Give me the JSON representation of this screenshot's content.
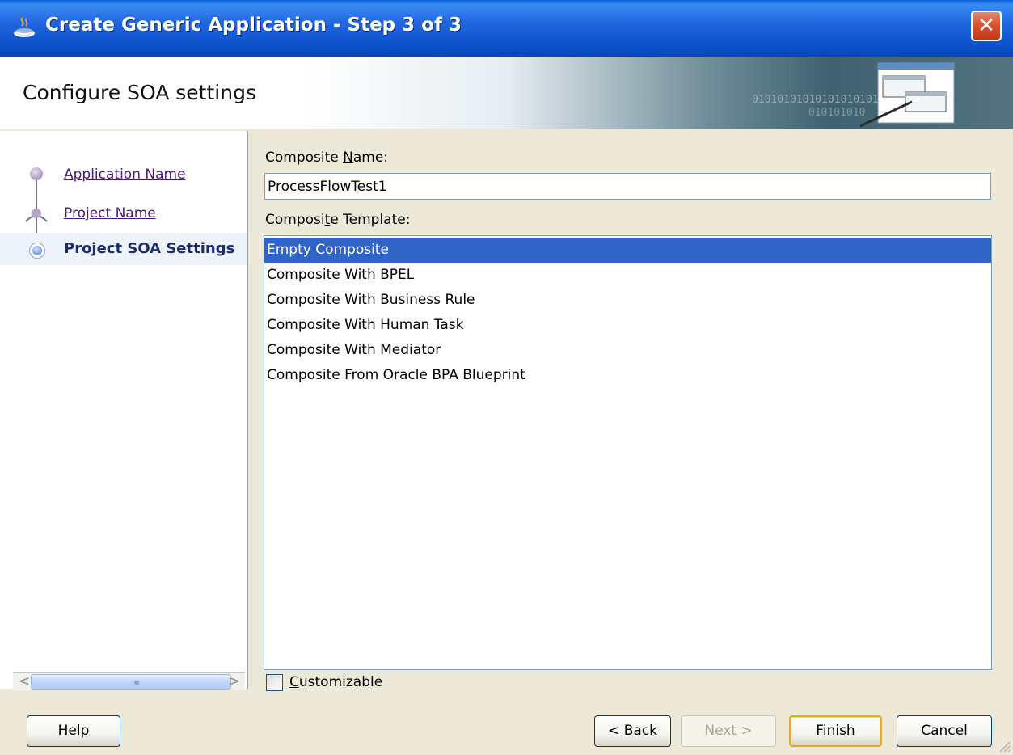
{
  "window": {
    "title": "Create Generic Application - Step 3 of 3",
    "close_glyph": "✕"
  },
  "banner": {
    "title": "Configure SOA settings",
    "decor_binary_1": "0101010101010101010101010101",
    "decor_binary_2": "010101010"
  },
  "nav": {
    "steps": [
      {
        "label": "Application Name",
        "state": "visited"
      },
      {
        "label": "Project Name",
        "state": "visited"
      },
      {
        "label": "Project SOA Settings",
        "state": "current"
      }
    ],
    "scroll_left": "<",
    "scroll_right": ">"
  },
  "form": {
    "composite_name_label_pre": "Composite ",
    "composite_name_label_mn": "N",
    "composite_name_label_post": "ame:",
    "composite_name_value": "ProcessFlowTest1",
    "template_label_pre": "Composi",
    "template_label_mn": "t",
    "template_label_post": "e Template:",
    "templates": [
      "Empty Composite",
      "Composite With BPEL",
      "Composite With Business Rule",
      "Composite With Human Task",
      "Composite With Mediator",
      "Composite From Oracle BPA Blueprint"
    ],
    "selected_template": "Empty Composite",
    "customizable_mn": "C",
    "customizable_rest": "ustomizable",
    "customizable_checked": false
  },
  "buttons": {
    "help_mn": "H",
    "help_rest": "elp",
    "back_pre": "< ",
    "back_mn": "B",
    "back_rest": "ack",
    "next_mn": "N",
    "next_rest": "ext >",
    "finish_mn": "F",
    "finish_rest": "inish",
    "cancel": "Cancel"
  },
  "colors": {
    "titlebar": "#0a4fc9",
    "selection": "#3165c5",
    "link_visited": "#4a1a7a",
    "current_step": "#1b2d6b"
  },
  "icons": {
    "title_icon": "java-cup-icon",
    "banner_art": "wizard-windows-icon"
  }
}
